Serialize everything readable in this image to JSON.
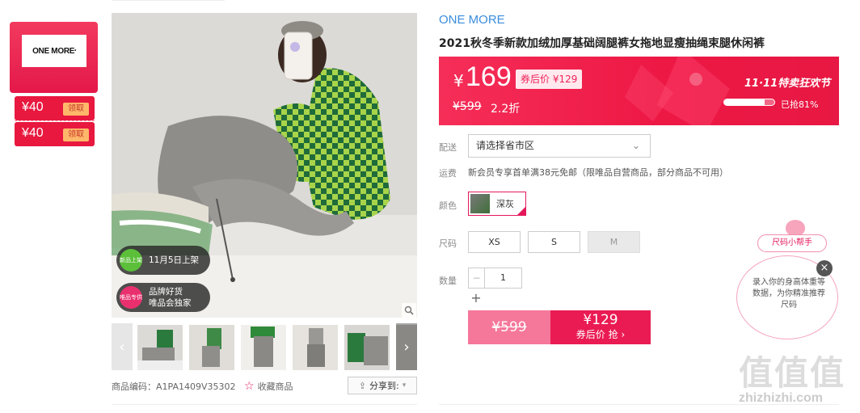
{
  "brand_card": {
    "logo_text": "ONE MORE"
  },
  "coupons": [
    {
      "amount": "¥40",
      "action": "领取"
    },
    {
      "amount": "¥40",
      "action": "领取"
    }
  ],
  "gallery": {
    "tags": [
      {
        "badge": "新品上架",
        "text": "11月5日上架",
        "color": "#5bbf3a"
      },
      {
        "badge": "唯品专供",
        "text": "品牌好货\n唯品会独家",
        "color": "#e9306e"
      }
    ],
    "thumbnail_count": 5
  },
  "meta": {
    "code_label": "商品编码：",
    "code_value": "A1PA1409V35302",
    "favorite_label": "收藏商品",
    "share_label": "分享到:"
  },
  "product": {
    "brand": "ONE MORE",
    "title": "2021秋冬季新款加绒加厚基础阔腿裤女拖地显瘦抽绳束腿休闲裤"
  },
  "price": {
    "currency": "¥",
    "current": "169",
    "after_coupon": "券后价 ¥129",
    "original": "¥599",
    "discount": "2.2折",
    "event": "11·11特卖狂欢节",
    "sold_percent": 81,
    "sold_label": "已抢81%"
  },
  "options": {
    "shipping_label": "配送",
    "shipping_placeholder": "请选择省市区",
    "freight_label": "运费",
    "freight_text": "新会员专享首单满38元免邮（限唯品自营商品，部分商品不可用）",
    "color_label": "颜色",
    "color_value": "深灰",
    "size_label": "尺码",
    "sizes": [
      "XS",
      "S",
      "M"
    ],
    "qty_label": "数量",
    "qty_value": "1",
    "qty_minus": "−",
    "qty_plus": "+"
  },
  "buy": {
    "original": "¥599",
    "price": "¥129",
    "action": "券后价 抢 ›"
  },
  "helper": {
    "tab": "尺码小帮手",
    "text": "录入你的身高体重等数据，为你精准推荐尺码",
    "close": "×"
  },
  "watermark": {
    "glyphs": "值值值",
    "text": "zhizhizhi.com"
  },
  "colors": {
    "accent": "#e4185a",
    "brand_link": "#3a8ddc",
    "banner": "#ee1845"
  }
}
